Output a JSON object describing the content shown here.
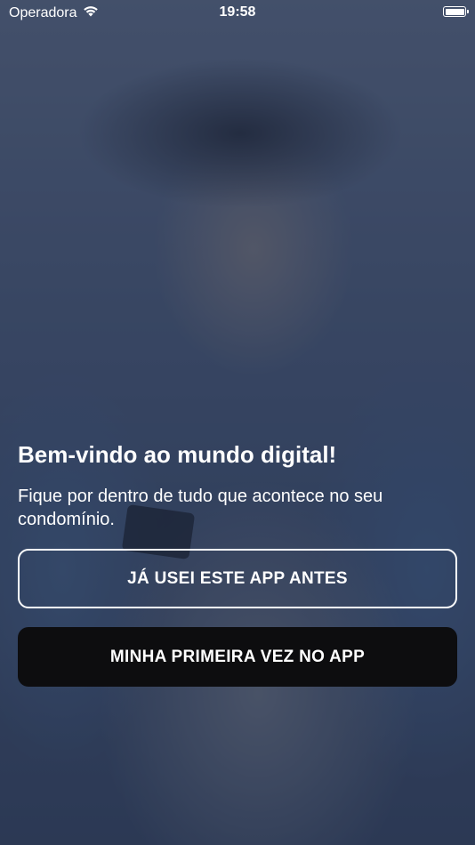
{
  "status_bar": {
    "carrier": "Operadora",
    "time": "19:58",
    "wifi_icon": "wifi-icon",
    "battery_icon": "battery-icon"
  },
  "welcome": {
    "title": "Bem-vindo ao mundo digital!",
    "subtitle": "Fique por dentro de tudo que acontece no seu condomínio."
  },
  "buttons": {
    "existing_user_label": "JÁ USEI ESTE APP ANTES",
    "first_time_label": "MINHA PRIMEIRA VEZ NO APP"
  },
  "colors": {
    "overlay": "#1f2b48",
    "primary_button": "#0d0d0f",
    "text": "#ffffff"
  }
}
